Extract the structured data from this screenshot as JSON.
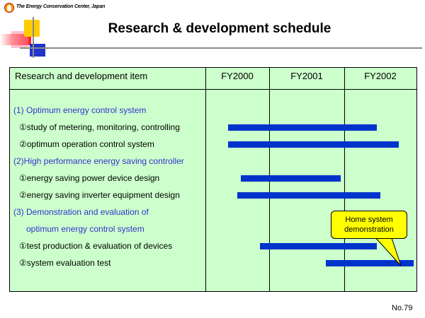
{
  "header": {
    "organization": "The Energy Conservation Center, Japan",
    "title": "Research & development schedule"
  },
  "table": {
    "item_header": "Research and development item",
    "years": [
      "FY2000",
      "FY2001",
      "FY2002"
    ]
  },
  "rows": [
    {
      "label": "(1) Optimum energy control system",
      "kind": "category"
    },
    {
      "label": "①study of metering, monitoring, controlling",
      "kind": "item"
    },
    {
      "label": "②optimum operation control system",
      "kind": "item"
    },
    {
      "label": "(2)High performance energy saving controller",
      "kind": "category"
    },
    {
      "label": "①energy saving power device design",
      "kind": "item"
    },
    {
      "label": "②energy saving inverter equipment design",
      "kind": "item"
    },
    {
      "label": "(3) Demonstration and evaluation of",
      "kind": "category"
    },
    {
      "label": "optimum energy control system",
      "kind": "category"
    },
    {
      "label": "①test production & evaluation of devices",
      "kind": "item"
    },
    {
      "label": "②system evaluation test",
      "kind": "item"
    }
  ],
  "schedule": [
    {
      "task": "①study of metering, monitoring, controlling",
      "start_fy": 2000.35,
      "end_fy": 2002.45
    },
    {
      "task": "②optimum operation control system",
      "start_fy": 2000.35,
      "end_fy": 2002.75
    },
    {
      "task": "①energy saving power device design",
      "start_fy": 2000.55,
      "end_fy": 2001.95
    },
    {
      "task": "②energy saving inverter equipment design",
      "start_fy": 2000.5,
      "end_fy": 2002.5
    },
    {
      "task": "①test production & evaluation of devices",
      "start_fy": 2000.85,
      "end_fy": 2002.45
    },
    {
      "task": "②system evaluation test",
      "start_fy": 2001.75,
      "end_fy": 2003.0
    }
  ],
  "callout": {
    "line1": "Home system",
    "line2": "demonstration"
  },
  "colors": {
    "panel": "#ccffcc",
    "bar": "#0033cc",
    "category_text": "#3333cc",
    "callout": "#ffff00"
  },
  "footer": {
    "page_number": "No.79"
  }
}
